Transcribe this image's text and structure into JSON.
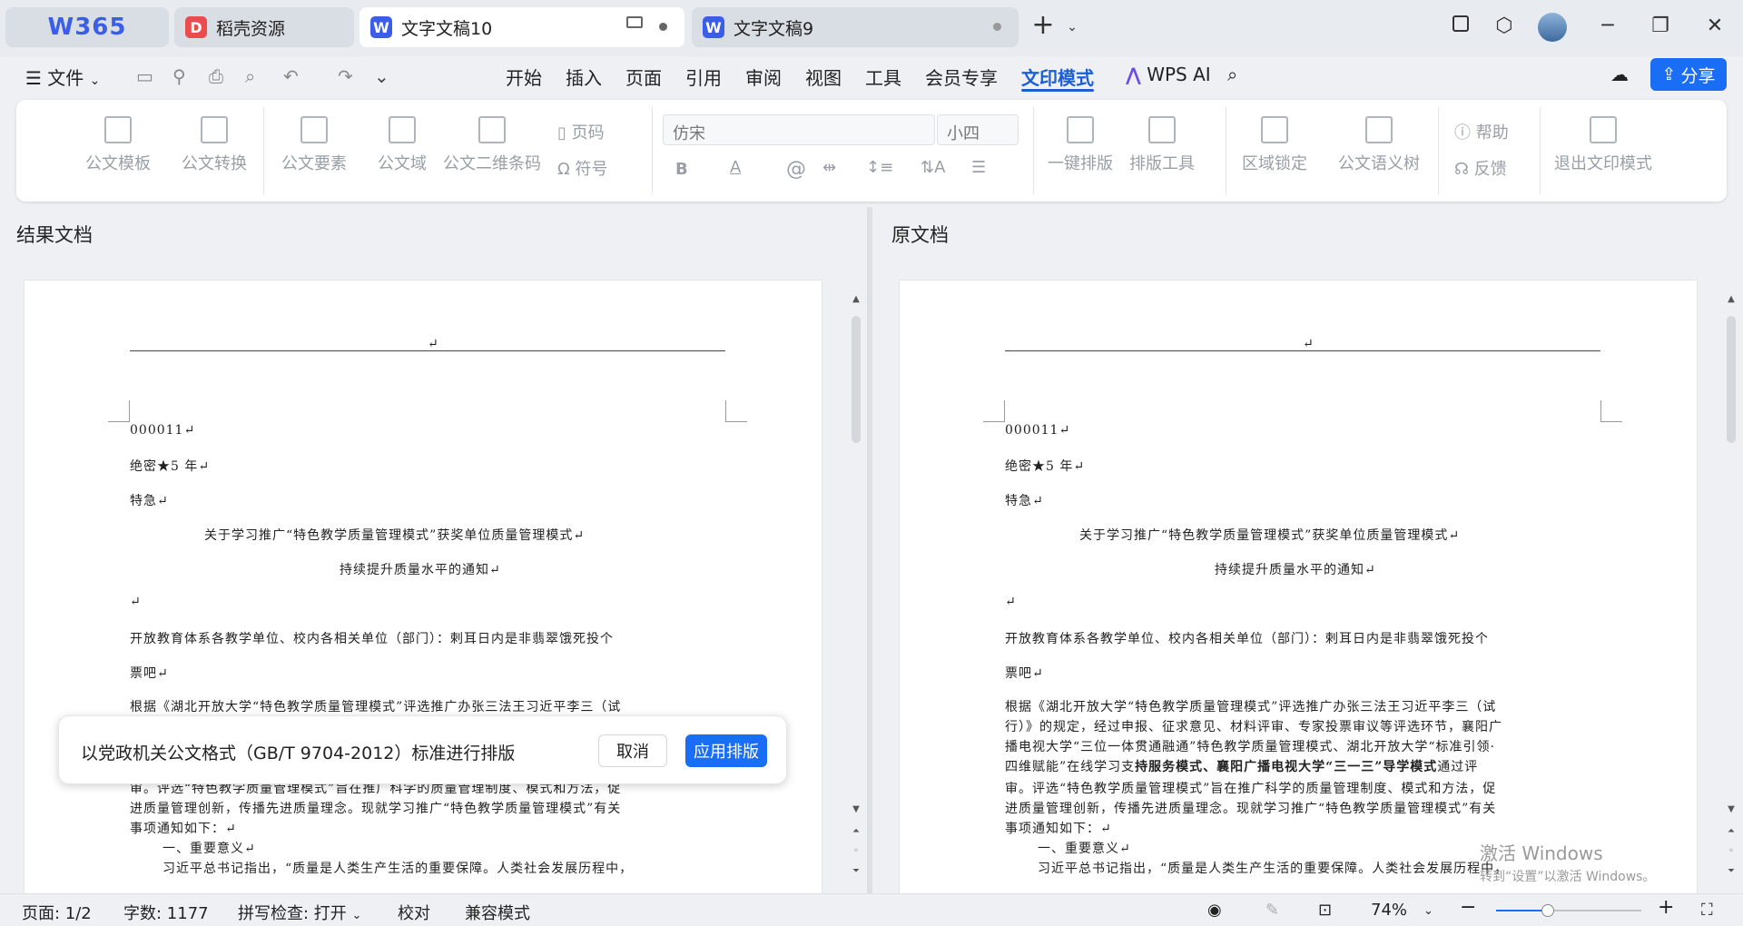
{
  "tabs": {
    "home_logo": "W365",
    "items": [
      {
        "label": "稻壳资源",
        "icon": "docer-icon",
        "color": "#e94d4d"
      },
      {
        "label": "文字文稿10",
        "icon": "wps-writer-icon",
        "color": "#3b5ee8"
      },
      {
        "label": "文字文稿9",
        "icon": "wps-writer-icon",
        "color": "#3b5ee8"
      }
    ],
    "new_tab": "+"
  },
  "menu": {
    "file": "文件",
    "items": [
      "开始",
      "插入",
      "页面",
      "引用",
      "审阅",
      "视图",
      "工具",
      "会员专享",
      "文印模式"
    ],
    "active": "文印模式",
    "wps_ai": "WPS AI",
    "share": "分享"
  },
  "ribbon": {
    "template": "公文模板",
    "convert": "公文转换",
    "elements": "公文要素",
    "domain": "公文域",
    "qrcode": "公文二维条码",
    "page_num": "页码",
    "symbol": "符号",
    "font_name": "仿宋",
    "font_size": "小四",
    "one_click": "一键排版",
    "layout_tools": "排版工具",
    "region_lock": "区域锁定",
    "semantic_tree": "公文语义树",
    "help": "帮助",
    "feedback": "反馈",
    "exit": "退出文印模式",
    "bold_glyph": "B",
    "color_glyph": "A",
    "at_glyph": "@"
  },
  "panels": {
    "result_title": "结果文档",
    "original_title": "原文档"
  },
  "doc": {
    "mark": "↵",
    "num": "000011↵",
    "secret": "绝密★5 年↵",
    "urgent": "特急↵",
    "title1": "关于学习推广“特色教学质量管理模式”获奖单位质量管理模式↵",
    "title2": "持续提升质量水平的通知↵",
    "blank": "↵",
    "addr1": "开放教育体系各教学单位、校内各相关单位（部门）：剌耳日内是非翡翠饿死投个",
    "addr2": "票吧↵",
    "body_lines": [
      "根据《湖北开放大学“特色教学质量管理模式”评选推广办张三法王习近平李三（试",
      "行）》的规定，经过申报、征求意见、材料评审、专家投票审议等评选环节，襄阳广",
      "播电视大学“三位一体贯通融通”特色教学质量管理模式、湖北开放大学“标准引领·",
      "四维赋能”在线学习支",
      "审。评选“特色教学质量管理模式”旨在推广科学的质量管理制度、模式和方法，促",
      "进质量管理创新，传播先进质量理念。现就学习推广“特色教学质量管理模式”有关",
      "事项通知如下：↵",
      "一、重要意义↵",
      "习近平总书记指出，“质量是人类生产生活的重要保障。人类社会发展历程中，"
    ],
    "body_bold": "持服务模式、襄阳广播电视大学“三一三”导学模式",
    "body_tail": "通过评",
    "result_hidden_line": "审。评选“特色教学质量管理模式”旨在推广科学的质量管理制度、模式和方法，促"
  },
  "popup": {
    "message": "以党政机关公文格式（GB/T 9704-2012）标准进行排版",
    "cancel": "取消",
    "apply": "应用排版"
  },
  "watermark": {
    "line1": "激活 Windows",
    "line2": "转到“设置”以激活 Windows。"
  },
  "status": {
    "page": "页面: 1/2",
    "words": "字数: 1177",
    "spell": "拼写检查: 打开",
    "proof": "校对",
    "compat": "兼容模式",
    "zoom": "74%",
    "zoom_level": 0.74
  },
  "colors": {
    "accent": "#1a5fd6",
    "apply_button": "#1a6ef5",
    "share_button": "#1a6ef5"
  }
}
